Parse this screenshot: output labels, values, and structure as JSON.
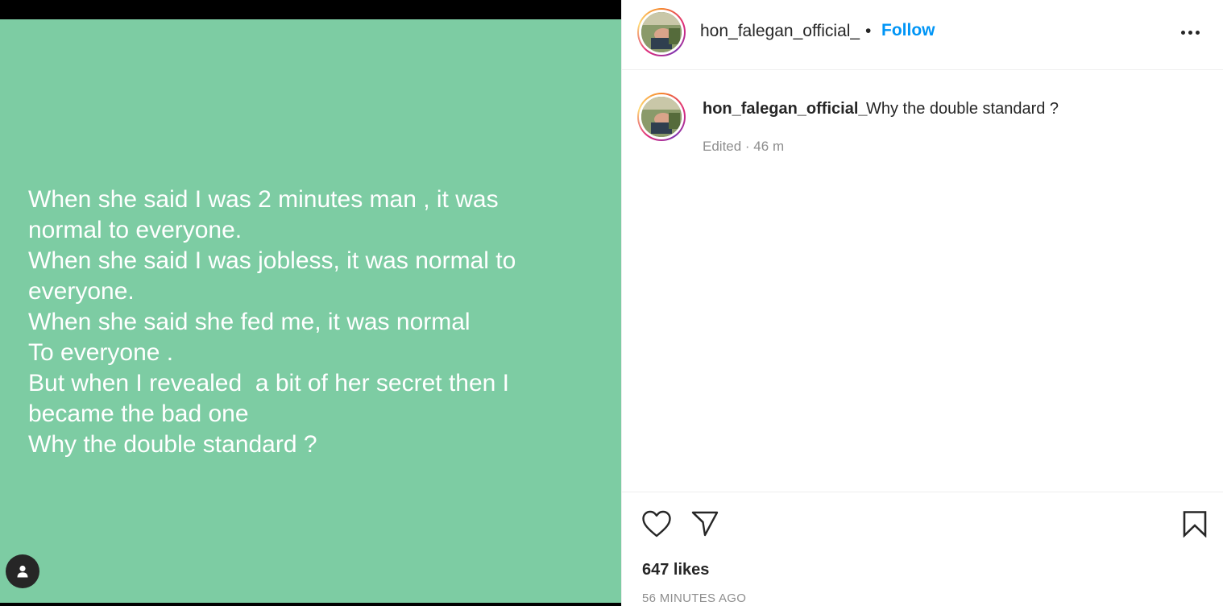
{
  "post": {
    "lines": [
      "When she said I was 2 minutes man , it was",
      "normal to everyone.",
      "When she said I was jobless, it was normal to",
      "everyone.",
      "When she said she fed me, it was normal",
      "To everyone .",
      "But when I revealed  a bit of her secret then I",
      "became the bad one",
      "Why the double standard ?"
    ],
    "background_color": "#7dcca3"
  },
  "header": {
    "username": "hon_falegan_official_",
    "separator": "•",
    "follow_label": "Follow"
  },
  "caption": {
    "username": "hon_falegan_official_",
    "text": "Why the double standard ?",
    "meta": "Edited · 46 m"
  },
  "footer": {
    "likes": "647 likes",
    "timestamp": "56 MINUTES AGO"
  },
  "icons": {
    "like": "heart-icon",
    "share": "paper-plane-icon",
    "save": "bookmark-icon",
    "more": "more-options-icon",
    "tag": "user-tag-icon"
  },
  "colors": {
    "accent": "#0095f6",
    "text": "#262626",
    "muted": "#8e8e8e"
  }
}
